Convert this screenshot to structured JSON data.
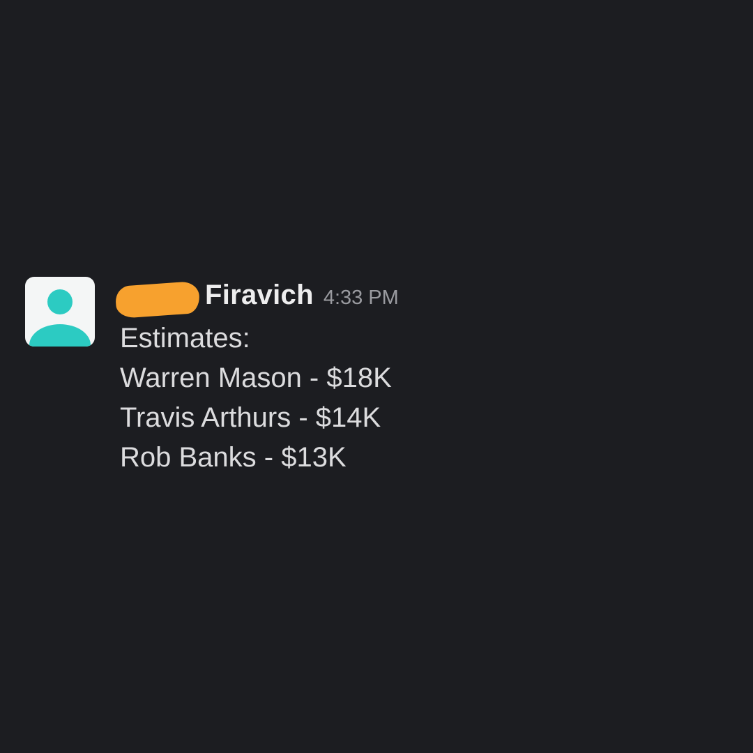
{
  "message": {
    "sender_name": "Firavich",
    "timestamp": "4:33 PM",
    "lines": [
      "Estimates:",
      "Warren Mason - $18K",
      "Travis Arthurs - $14K",
      "Rob Banks - $13K"
    ]
  },
  "avatar": {
    "icon": "user-silhouette-icon",
    "accent_color": "#2ccbc2"
  },
  "redaction": {
    "color": "#f7a12e"
  }
}
